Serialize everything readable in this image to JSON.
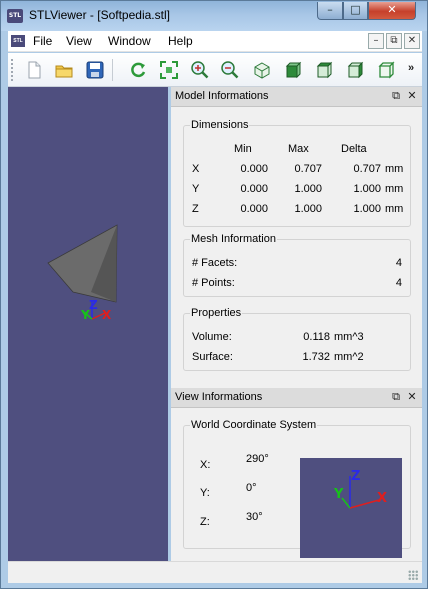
{
  "window": {
    "title": "STLViewer - [Softpedia.stl]",
    "app_icon_text": "STL",
    "buttons": {
      "minimize": "–",
      "maximize": "□",
      "close": "✕"
    }
  },
  "menubar": {
    "items": [
      "File",
      "View",
      "Window",
      "Help"
    ],
    "mdi_buttons": {
      "minimize": "–",
      "restore": "⧉",
      "close": "✕"
    }
  },
  "toolbar": {
    "buttons": [
      "new-file-icon",
      "open-folder-icon",
      "save-icon",
      "rotate-icon",
      "fit-all-icon",
      "zoom-in-icon",
      "zoom-out-icon",
      "view-iso-icon",
      "view-front-icon",
      "view-top-icon",
      "view-side-icon",
      "view-wire-icon"
    ],
    "overflow": "»"
  },
  "viewport": {
    "background": "#4f4f7f",
    "axis_labels": {
      "x": "X",
      "y": "Y",
      "z": "Z"
    }
  },
  "model_info": {
    "title": "Model Informations",
    "dimensions": {
      "title": "Dimensions",
      "headers": [
        "Min",
        "Max",
        "Delta"
      ],
      "rows": [
        {
          "axis": "X",
          "min": "0.000",
          "max": "0.707",
          "delta": "0.707",
          "unit": "mm"
        },
        {
          "axis": "Y",
          "min": "0.000",
          "max": "1.000",
          "delta": "1.000",
          "unit": "mm"
        },
        {
          "axis": "Z",
          "min": "0.000",
          "max": "1.000",
          "delta": "1.000",
          "unit": "mm"
        }
      ]
    },
    "mesh": {
      "title": "Mesh Information",
      "facets_label": "# Facets:",
      "facets_value": "4",
      "points_label": "# Points:",
      "points_value": "4"
    },
    "properties": {
      "title": "Properties",
      "volume_label": "Volume:",
      "volume_value": "0.118",
      "volume_unit": "mm^3",
      "surface_label": "Surface:",
      "surface_value": "1.732",
      "surface_unit": "mm^2"
    }
  },
  "view_info": {
    "title": "View Informations",
    "wcs": {
      "title": "World Coordinate System",
      "x_label": "X:",
      "x_value": "290°",
      "y_label": "Y:",
      "y_value": "0°",
      "z_label": "Z:",
      "z_value": "30°"
    }
  },
  "colors": {
    "viewport_bg": "#4f4f7f",
    "axis_x": "#e01e1e",
    "axis_y": "#17c21a",
    "axis_z": "#2a2ae8",
    "model_gray": "#6d6d6d"
  }
}
